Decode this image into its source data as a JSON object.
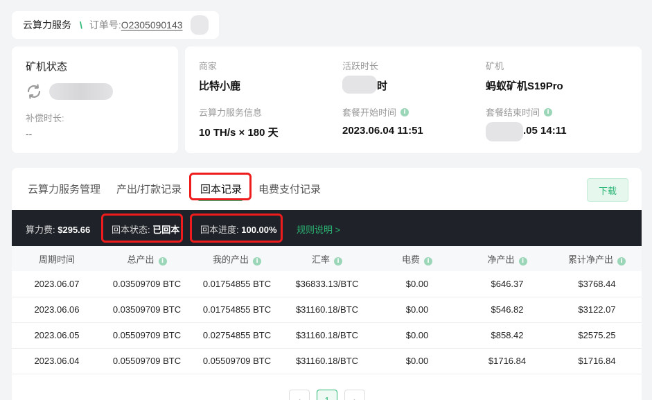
{
  "breadcrumb": {
    "service": "云算力服务",
    "separator": "\\",
    "order_label": "订单号:",
    "order_no": "O2305090143"
  },
  "status_card": {
    "title": "矿机状态",
    "icon": "sync-icon",
    "compensation_label": "补偿时长:",
    "compensation_value": "--"
  },
  "info": {
    "merchant_label": "商家",
    "merchant_value": "比特小鹿",
    "active_label": "活跃时长",
    "active_value_suffix": "时",
    "miner_label": "矿机",
    "miner_value": "蚂蚁矿机S19Pro",
    "service_label": "云算力服务信息",
    "service_value": "10 TH/s × 180 天",
    "start_label": "套餐开始时间",
    "start_value": "2023.06.04 11:51",
    "end_label": "套餐结束时间",
    "end_value_suffix": ".05 14:11"
  },
  "tabs": [
    {
      "label": "云算力服务管理"
    },
    {
      "label": "产出/打款记录"
    },
    {
      "label": "回本记录"
    },
    {
      "label": "电费支付记录"
    }
  ],
  "active_tab": "回本记录",
  "download_label": "下载",
  "summary": {
    "fee_label": "算力费:",
    "fee_value": "$295.66",
    "status_label": "回本状态:",
    "status_value": "已回本",
    "progress_label": "回本进度:",
    "progress_value": "100.00%",
    "rules_link": "规则说明 >"
  },
  "table": {
    "headers": [
      "周期时间",
      "总产出",
      "我的产出",
      "汇率",
      "电费",
      "净产出",
      "累计净产出"
    ],
    "rows": [
      [
        "2023.06.07",
        "0.03509709 BTC",
        "0.01754855 BTC",
        "$36833.13/BTC",
        "$0.00",
        "$646.37",
        "$3768.44"
      ],
      [
        "2023.06.06",
        "0.03509709 BTC",
        "0.01754855 BTC",
        "$31160.18/BTC",
        "$0.00",
        "$546.82",
        "$3122.07"
      ],
      [
        "2023.06.05",
        "0.05509709 BTC",
        "0.02754855 BTC",
        "$31160.18/BTC",
        "$0.00",
        "$858.42",
        "$2575.25"
      ],
      [
        "2023.06.04",
        "0.05509709 BTC",
        "0.05509709 BTC",
        "$31160.18/BTC",
        "$0.00",
        "$1716.84",
        "$1716.84"
      ]
    ]
  },
  "pagination": {
    "prev": "‹",
    "current": "1",
    "next": "›"
  },
  "colors": {
    "accent": "#2ab673",
    "highlight": "#ee1c1c",
    "summary_bg": "#1f2329"
  }
}
